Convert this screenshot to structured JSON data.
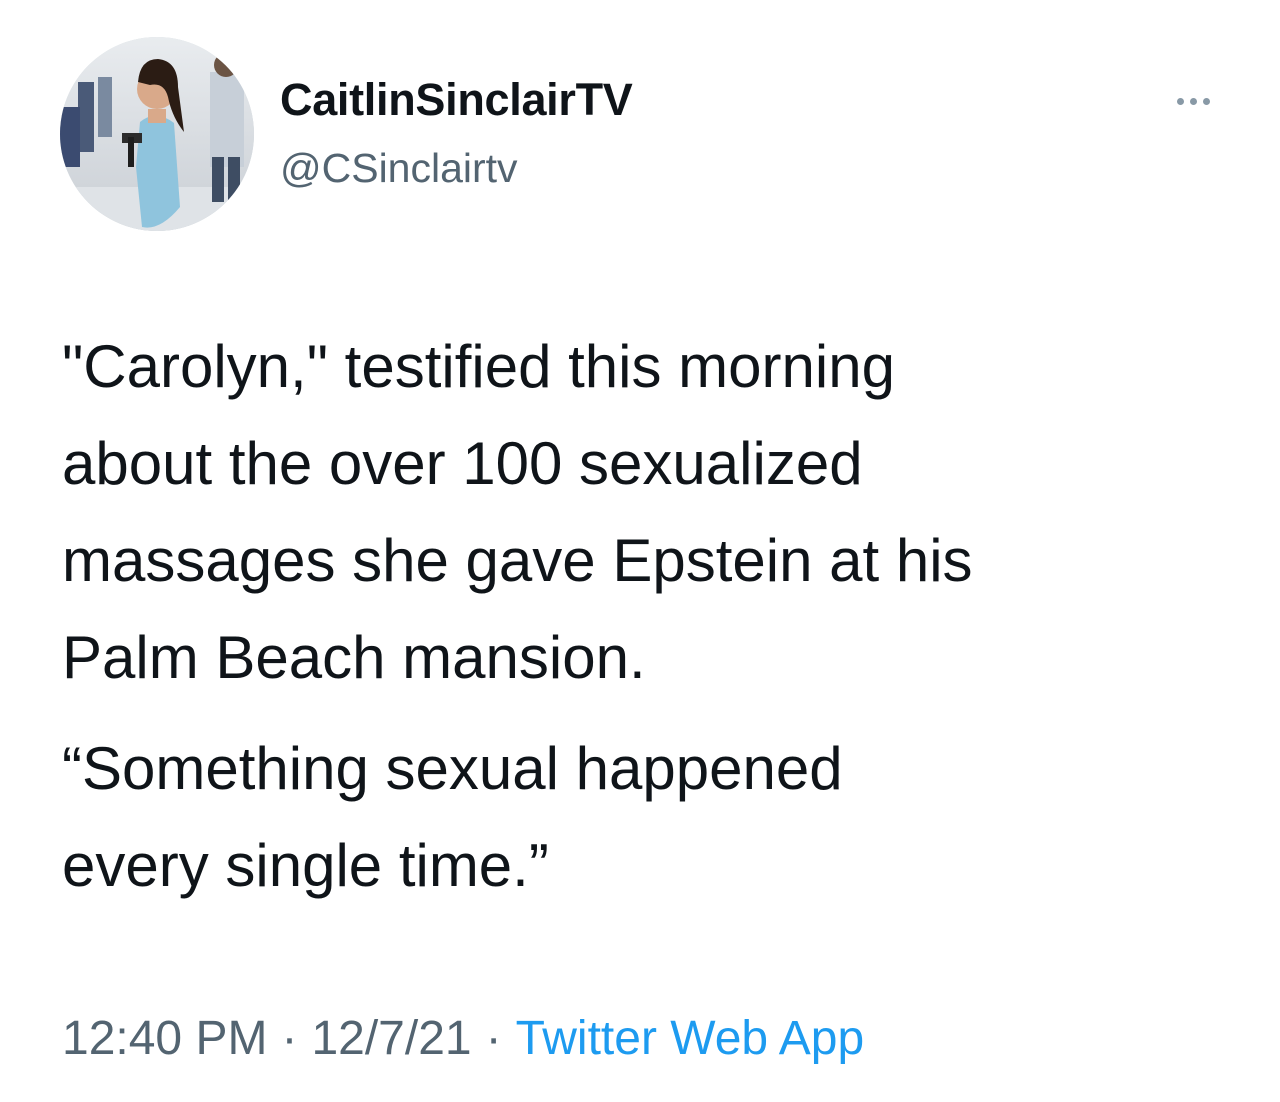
{
  "author": {
    "display_name": "CaitlinSinclairTV",
    "handle": "@CSinclairtv"
  },
  "more_icon": "more-horizontal-icon",
  "tweet": {
    "paragraphs": [
      "\"Carolyn,\" testified this morning\nabout the over 100 sexualized\nmassages she gave Epstein at his\nPalm Beach mansion.",
      "“Something sexual happened\nevery single time.”"
    ]
  },
  "meta": {
    "time": "12:40 PM",
    "separator": "·",
    "date": "12/7/21",
    "source": "Twitter Web App"
  },
  "colors": {
    "text": "#0f1419",
    "secondary": "#536471",
    "link": "#1d9bf0"
  }
}
